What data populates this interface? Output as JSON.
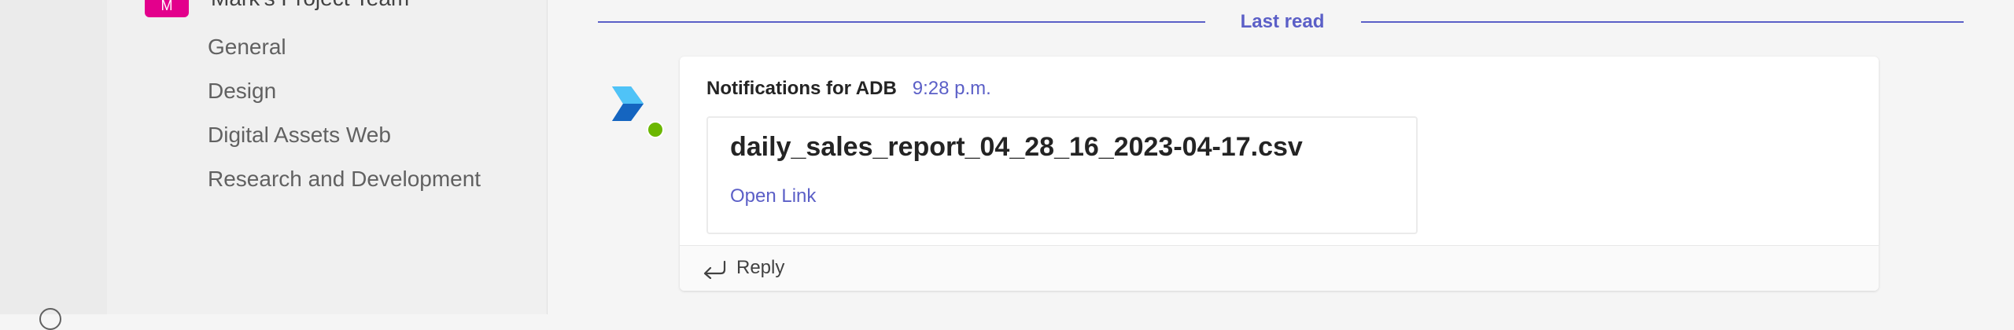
{
  "sidebar": {
    "team": {
      "name": "Mark's Project Team",
      "initials": "M"
    },
    "channels": [
      {
        "label": "General"
      },
      {
        "label": "Design"
      },
      {
        "label": "Digital Assets Web"
      },
      {
        "label": "Research and Development"
      }
    ]
  },
  "chat": {
    "last_read_label": "Last read",
    "message": {
      "sender": "Notifications for ADB",
      "timestamp": "9:28 p.m.",
      "attachment": {
        "file_name": "daily_sales_report_04_28_16_2023-04-17.csv",
        "link_label": "Open Link"
      },
      "reply_label": "Reply"
    }
  },
  "colors": {
    "accent": "#5b5fc7",
    "team_avatar": "#e3008c",
    "presence_available": "#6bb700",
    "bot_icon": "#1e88e5"
  },
  "icons": {
    "bot_avatar": "azure-pipelines-icon",
    "presence": "presence-available-icon",
    "reply": "reply-arrow-icon"
  }
}
